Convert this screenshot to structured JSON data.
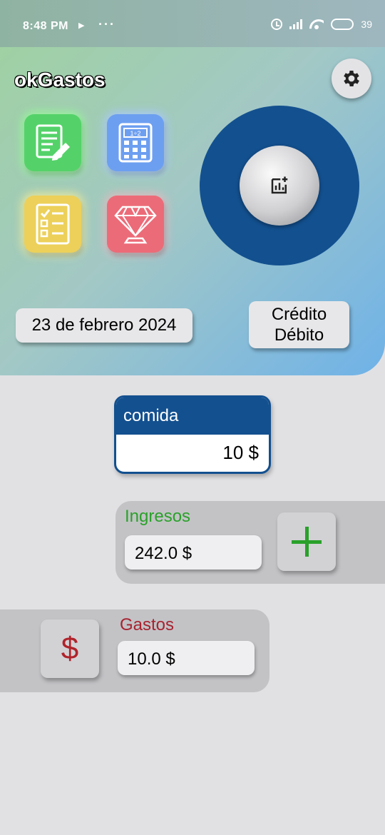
{
  "status_bar": {
    "time": "8:48 PM",
    "play_symbol": "▶",
    "more_symbol": "···",
    "battery_level": "39",
    "battery_fraction": 0.39
  },
  "header": {
    "app_title": "okGastos",
    "settings_icon": "gear-icon",
    "tiles": [
      {
        "icon": "document-edit-icon",
        "color": "#54d269"
      },
      {
        "icon": "calculator-icon",
        "color": "#6d9ff0"
      },
      {
        "icon": "checklist-icon",
        "color": "#ecd05a"
      },
      {
        "icon": "diamond-icon",
        "color": "#ec6b78"
      }
    ],
    "calculator_display": "1÷2",
    "center_button_icon": "add-chart-icon",
    "ring_color": "#13508f",
    "date": "23 de febrero 2024",
    "mode": {
      "line1": "Crédito",
      "line2": "Débito"
    }
  },
  "category": {
    "name": "comida",
    "amount": "10 $"
  },
  "income": {
    "label": "Ingresos",
    "value": "242.0 $",
    "add_icon": "plus-icon",
    "color": "#2aa12a"
  },
  "expense": {
    "label": "Gastos",
    "value": "10.0 $",
    "button_symbol": "$",
    "color": "#a72330"
  }
}
